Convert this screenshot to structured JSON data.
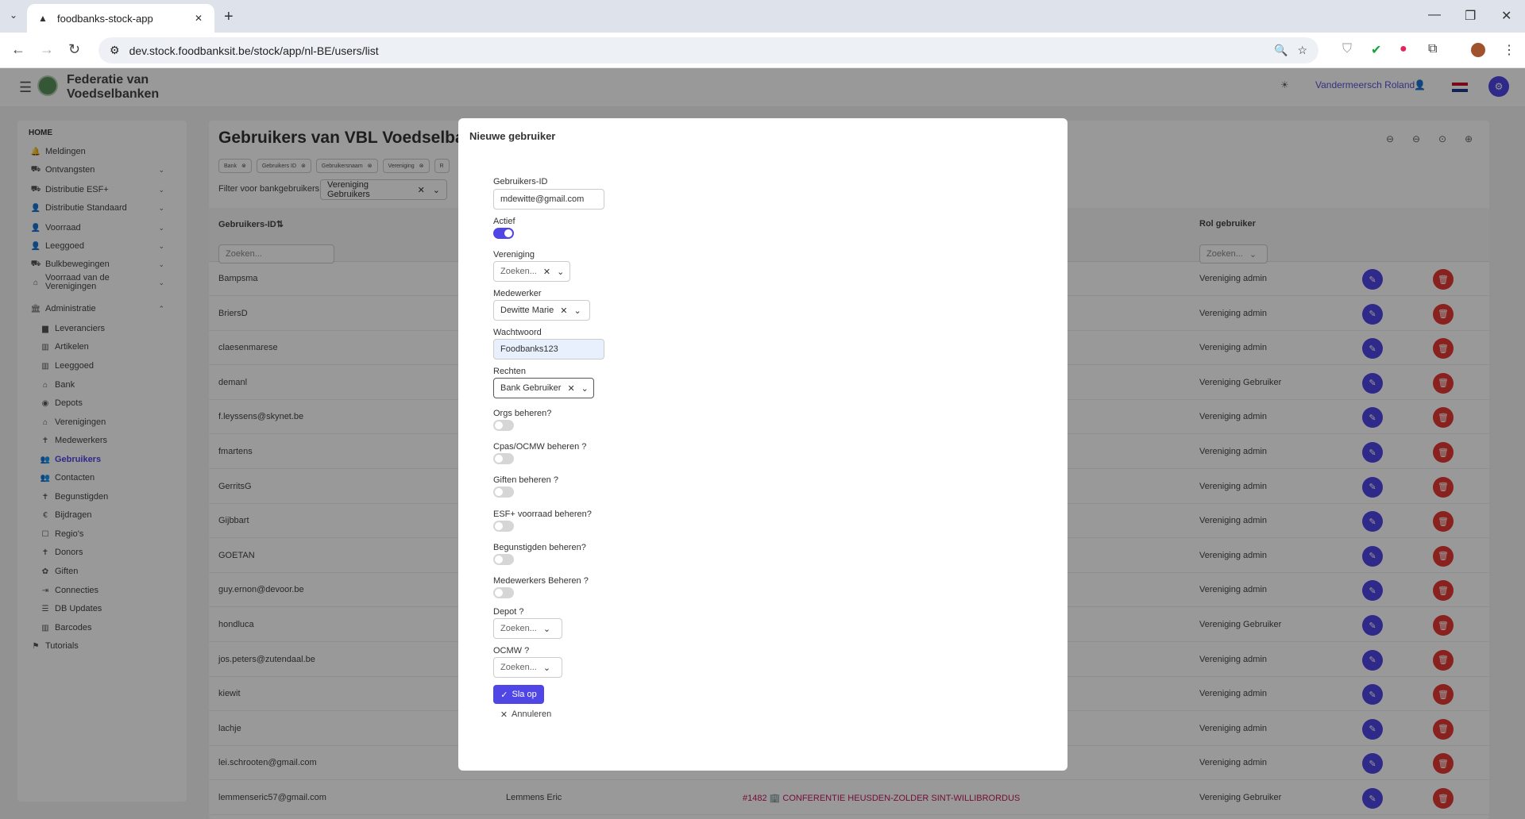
{
  "browser": {
    "tab_title": "foodbanks-stock-app",
    "url": "dev.stock.foodbanksit.be/stock/app/nl-BE/users/list"
  },
  "app": {
    "name_line1": "Federatie van",
    "name_line2": "Voedselbanken",
    "user_name": "Vandermeersch Roland"
  },
  "sidebar": {
    "home": "HOME",
    "items": [
      {
        "label": "Meldingen",
        "icon": "bell-icon",
        "glyph": "🔔"
      },
      {
        "label": "Ontvangsten",
        "icon": "truck-icon",
        "glyph": "⛟",
        "chevron": "⌄"
      },
      {
        "label": "Distributie ESF+",
        "icon": "truck-icon",
        "glyph": "⛟",
        "chevron": "⌄"
      },
      {
        "label": "Distributie Standaard",
        "icon": "person-icon",
        "glyph": "👤",
        "chevron": "⌄"
      },
      {
        "label": "Voorraad",
        "icon": "person-icon",
        "glyph": "👤",
        "chevron": "⌄"
      },
      {
        "label": "Leeggoed",
        "icon": "person-icon",
        "glyph": "👤",
        "chevron": "⌄"
      },
      {
        "label": "Bulkbewegingen",
        "icon": "truck-icon",
        "glyph": "⛟",
        "chevron": "⌄"
      },
      {
        "label": "Voorraad van de",
        "label2": "Verenigingen",
        "icon": "warehouse-icon",
        "glyph": "⌂",
        "chevron": "⌄"
      },
      {
        "label": "Administratie",
        "icon": "building-icon",
        "glyph": "🏛",
        "chevron": "⌃"
      },
      {
        "label": "Leveranciers",
        "icon": "folder-icon",
        "glyph": "▆"
      },
      {
        "label": "Artikelen",
        "icon": "barcode-icon",
        "glyph": "▥"
      },
      {
        "label": "Leeggoed",
        "icon": "barcode-icon",
        "glyph": "▥"
      },
      {
        "label": "Bank",
        "icon": "bank-icon",
        "glyph": "⌂"
      },
      {
        "label": "Depots",
        "icon": "pin-icon",
        "glyph": "◉"
      },
      {
        "label": "Verenigingen",
        "icon": "warehouse-icon",
        "glyph": "⌂"
      },
      {
        "label": "Medewerkers",
        "icon": "person-icon",
        "glyph": "✝"
      },
      {
        "label": "Gebruikers",
        "icon": "users-icon",
        "glyph": "👥",
        "active": true
      },
      {
        "label": "Contacten",
        "icon": "users-icon",
        "glyph": "👥"
      },
      {
        "label": "Begunstigden",
        "icon": "person-icon",
        "glyph": "✝"
      },
      {
        "label": "Bijdragen",
        "icon": "euro-icon",
        "glyph": "€"
      },
      {
        "label": "Regio's",
        "icon": "square-icon",
        "glyph": "☐"
      },
      {
        "label": "Donors",
        "icon": "person-icon",
        "glyph": "✝"
      },
      {
        "label": "Giften",
        "icon": "gift-icon",
        "glyph": "✿"
      },
      {
        "label": "Connecties",
        "icon": "login-icon",
        "glyph": "⇥"
      },
      {
        "label": "DB Updates",
        "icon": "database-icon",
        "glyph": "☰"
      },
      {
        "label": "Barcodes",
        "icon": "barcode-icon",
        "glyph": "▥"
      },
      {
        "label": "Tutorials",
        "icon": "tutorial-icon",
        "glyph": "⚑"
      }
    ]
  },
  "page": {
    "title": "Gebruikers van VBL Voedselba",
    "chips": [
      "Bank",
      "Gebruikers ID",
      "Gebruikersnaam",
      "Vereniging",
      "R"
    ],
    "filter_label": "Filter voor bankgebruikers",
    "filter_value": "Vereniging Gebruikers",
    "col_user_id": "Gebruikers-ID",
    "col_role": "Rol gebruiker",
    "search_placeholder": "Zoeken...",
    "role_placeholder": "Zoeken...",
    "rows": [
      {
        "uid": "Bampsma",
        "role": "Vereniging admin"
      },
      {
        "uid": "BriersD",
        "role": "Vereniging admin"
      },
      {
        "uid": "claesenmarese",
        "role": "Vereniging admin"
      },
      {
        "uid": "demanl",
        "role": "Vereniging Gebruiker"
      },
      {
        "uid": "f.leyssens@skynet.be",
        "role": "Vereniging admin"
      },
      {
        "uid": "fmartens",
        "role": "Vereniging admin"
      },
      {
        "uid": "GerritsG",
        "role": "Vereniging admin"
      },
      {
        "uid": "Gijbbart",
        "role": "Vereniging admin"
      },
      {
        "uid": "GOETAN",
        "role": "Vereniging admin"
      },
      {
        "uid": "guy.ernon@devoor.be",
        "role": "Vereniging admin"
      },
      {
        "uid": "hondluca",
        "role": "Vereniging Gebruiker"
      },
      {
        "uid": "jos.peters@zutendaal.be",
        "role": "Vereniging admin"
      },
      {
        "uid": "kiewit",
        "role": "Vereniging admin"
      },
      {
        "uid": "lachje",
        "role": "Vereniging admin"
      },
      {
        "uid": "lei.schrooten@gmail.com",
        "role": "Vereniging admin"
      },
      {
        "uid": "lemmenseric57@gmail.com",
        "mid": "Lemmens Eric",
        "org": "#1482 🏢 CONFERENTIE HEUSDEN-ZOLDER SINT-WILLIBRORDUS",
        "role": "Vereniging Gebruiker"
      }
    ]
  },
  "modal": {
    "title": "Nieuwe gebruiker",
    "user_id_label": "Gebruikers-ID",
    "user_id_value": "mdewitte@gmail.com",
    "active_label": "Actief",
    "active": true,
    "org_label": "Vereniging",
    "org_placeholder": "Zoeken...",
    "employee_label": "Medewerker",
    "employee_value": "Dewitte Marie",
    "password_label": "Wachtwoord",
    "password_value": "Foodbanks123",
    "rights_label": "Rechten",
    "rights_value": "Bank Gebruiker",
    "toggles": [
      {
        "label": "Orgs beheren?",
        "on": false
      },
      {
        "label": "Cpas/OCMW beheren ?",
        "on": false
      },
      {
        "label": "Giften beheren ?",
        "on": false
      },
      {
        "label": "ESF+ voorraad beheren?",
        "on": false
      },
      {
        "label": "Begunstigden beheren?",
        "on": false
      },
      {
        "label": "Medewerkers Beheren ?",
        "on": false
      }
    ],
    "depot_label": "Depot ?",
    "depot_placeholder": "Zoeken...",
    "ocmw_label": "OCMW ?",
    "ocmw_placeholder": "Zoeken...",
    "save_label": "Sla op",
    "cancel_label": "Annuleren"
  },
  "colors": {
    "accent": "#4f46e5",
    "danger": "#e53935",
    "org_link": "#c2185b"
  }
}
